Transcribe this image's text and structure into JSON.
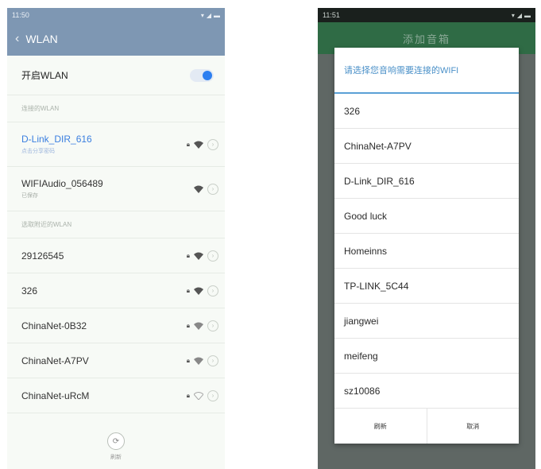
{
  "left_phone": {
    "status_time": "11:50",
    "title": "WLAN",
    "toggle_label": "开启WLAN",
    "toggle_on": true,
    "connected_section": "连接的WLAN",
    "connected_network": {
      "name": "D-Link_DIR_616",
      "sub": "点击分享密码"
    },
    "saved_network": {
      "name": "WIFIAudio_056489",
      "sub": "已保存"
    },
    "nearby_section": "选取附近的WLAN",
    "nearby_networks": [
      {
        "name": "29126545"
      },
      {
        "name": "326"
      },
      {
        "name": "ChinaNet-0B32"
      },
      {
        "name": "ChinaNet-A7PV"
      },
      {
        "name": "ChinaNet-uRcM"
      }
    ],
    "refresh_label": "刷新"
  },
  "right_phone": {
    "status_time": "11:51",
    "appbar_title": "添加音箱",
    "dialog": {
      "title": "请选择您音响需要连接的WIFI",
      "options": [
        "326",
        "ChinaNet-A7PV",
        "D-Link_DIR_616",
        "Good luck",
        "Homeinns",
        "TP-LINK_5C44",
        "jiangwei",
        "meifeng",
        "sz10086"
      ],
      "refresh_label": "刷新",
      "cancel_label": "取消"
    }
  },
  "colors": {
    "left_header": "#7e97b3",
    "right_header": "#2f6b45",
    "accent_blue": "#3b7fe0"
  }
}
